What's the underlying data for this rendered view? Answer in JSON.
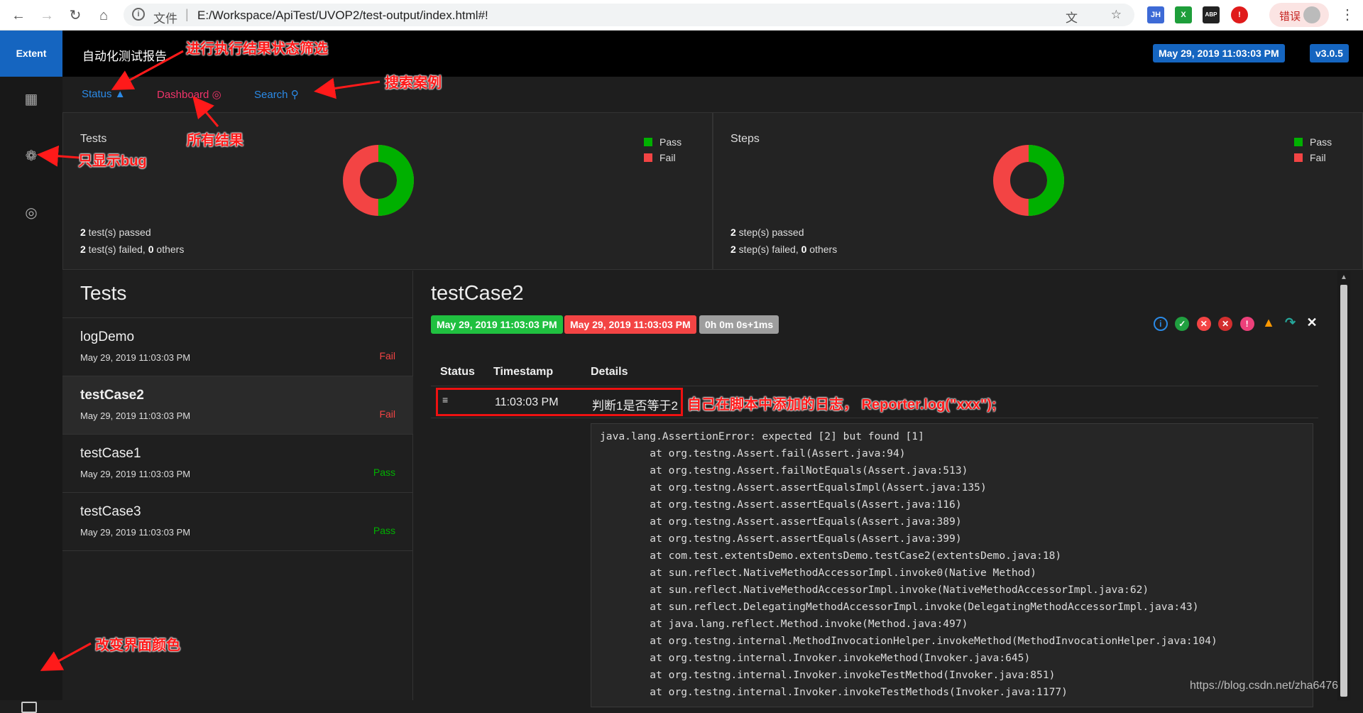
{
  "browser": {
    "address_file_label": "文件",
    "address_separator": "|",
    "url": "E:/Workspace/ApiTest/UVOP2/test-output/index.html#!",
    "error_label": "错误",
    "extensions": [
      "JH",
      "X",
      "ABP",
      "!"
    ]
  },
  "app": {
    "brand": "Extent",
    "report_title": "自动化测试报告",
    "date_badge": "May 29, 2019 11:03:03 PM",
    "version_badge": "v3.0.5"
  },
  "subnav": {
    "status": "Status",
    "dashboard": "Dashboard",
    "search": "Search"
  },
  "dashboard": {
    "tests_card": {
      "title": "Tests",
      "legend_pass": "Pass",
      "legend_fail": "Fail",
      "passed_count": "2",
      "passed_text": " test(s) passed",
      "failed_count": "2",
      "failed_text": " test(s) failed, ",
      "others_count": "0",
      "others_text": " others"
    },
    "steps_card": {
      "title": "Steps",
      "legend_pass": "Pass",
      "legend_fail": "Fail",
      "passed_count": "2",
      "passed_text": " step(s) passed",
      "failed_count": "2",
      "failed_text": " step(s) failed, ",
      "others_count": "0",
      "others_text": " others"
    },
    "pass_fraction": 0.5,
    "colors": {
      "pass": "#00b000",
      "fail": "#f34444"
    }
  },
  "tests_list": {
    "heading": "Tests",
    "items": [
      {
        "name": "logDemo",
        "time": "May 29, 2019 11:03:03 PM",
        "status": "Fail"
      },
      {
        "name": "testCase2",
        "time": "May 29, 2019 11:03:03 PM",
        "status": "Fail"
      },
      {
        "name": "testCase1",
        "time": "May 29, 2019 11:03:03 PM",
        "status": "Pass"
      },
      {
        "name": "testCase3",
        "time": "May 29, 2019 11:03:03 PM",
        "status": "Pass"
      }
    ]
  },
  "detail": {
    "title": "testCase2",
    "start_time": "May 29, 2019 11:03:03 PM",
    "end_time": "May 29, 2019 11:03:03 PM",
    "duration": "0h 0m 0s+1ms",
    "columns": [
      "Status",
      "Timestamp",
      "Details"
    ],
    "log_row": {
      "timestamp": "11:03:03 PM",
      "details": "判断1是否等于2"
    },
    "stack_trace": "java.lang.AssertionError: expected [2] but found [1]\n\tat org.testng.Assert.fail(Assert.java:94)\n\tat org.testng.Assert.failNotEquals(Assert.java:513)\n\tat org.testng.Assert.assertEqualsImpl(Assert.java:135)\n\tat org.testng.Assert.assertEquals(Assert.java:116)\n\tat org.testng.Assert.assertEquals(Assert.java:389)\n\tat org.testng.Assert.assertEquals(Assert.java:399)\n\tat com.test.extentsDemo.extentsDemo.testCase2(extentsDemo.java:18)\n\tat sun.reflect.NativeMethodAccessorImpl.invoke0(Native Method)\n\tat sun.reflect.NativeMethodAccessorImpl.invoke(NativeMethodAccessorImpl.java:62)\n\tat sun.reflect.DelegatingMethodAccessorImpl.invoke(DelegatingMethodAccessorImpl.java:43)\n\tat java.lang.reflect.Method.invoke(Method.java:497)\n\tat org.testng.internal.MethodInvocationHelper.invokeMethod(MethodInvocationHelper.java:104)\n\tat org.testng.internal.Invoker.invokeMethod(Invoker.java:645)\n\tat org.testng.internal.Invoker.invokeTestMethod(Invoker.java:851)\n\tat org.testng.internal.Invoker.invokeTestMethods(Invoker.java:1177)"
  },
  "annotations": {
    "status_filter": "进行执行结果状态筛选",
    "search_cases": "搜索案例",
    "all_results": "所有结果",
    "bug_only": "只显示bug",
    "change_color": "改变界面颜色",
    "custom_log": "自己在脚本中添加的日志，  Reporter.log(\"xxx\");"
  },
  "watermark": "https://blog.csdn.net/zha6476"
}
